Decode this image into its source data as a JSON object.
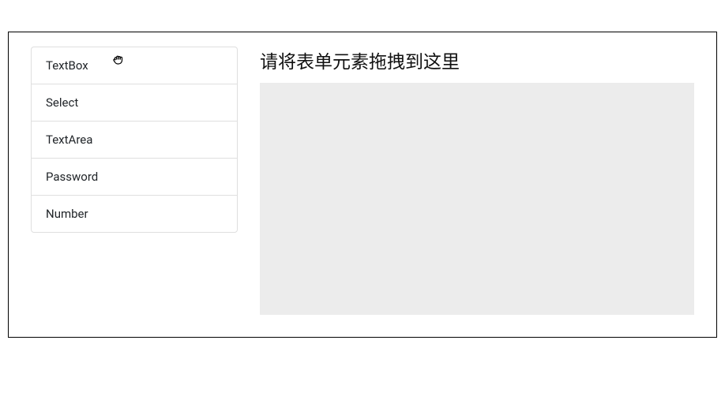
{
  "sidebar": {
    "elements": [
      {
        "label": "TextBox"
      },
      {
        "label": "Select"
      },
      {
        "label": "TextArea"
      },
      {
        "label": "Password"
      },
      {
        "label": "Number"
      }
    ]
  },
  "main": {
    "drop_title": "请将表单元素拖拽到这里"
  }
}
